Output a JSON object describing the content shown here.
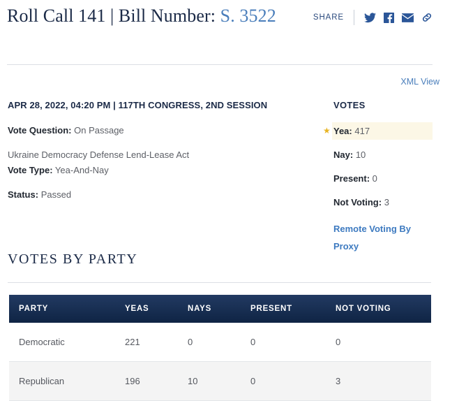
{
  "header": {
    "title_prefix": "Roll Call 141 | Bill Number: ",
    "bill_number": "S. 3522",
    "share_label": "SHARE",
    "icons": [
      "twitter-icon",
      "facebook-icon",
      "email-icon",
      "link-icon"
    ]
  },
  "xml_view": "XML View",
  "meta": {
    "datestamp": "APR 28, 2022, 04:20 PM | 117TH CONGRESS, 2ND SESSION",
    "vote_question_label": "Vote Question:",
    "vote_question_value": "On Passage",
    "bill_title": "Ukraine Democracy Defense Lend-Lease Act",
    "vote_type_label": "Vote Type:",
    "vote_type_value": "Yea-And-Nay",
    "status_label": "Status:",
    "status_value": "Passed"
  },
  "votes": {
    "heading": "VOTES",
    "yea_label": "Yea:",
    "yea_value": "417",
    "nay_label": "Nay:",
    "nay_value": "10",
    "present_label": "Present:",
    "present_value": "0",
    "not_voting_label": "Not Voting:",
    "not_voting_value": "3",
    "proxy_link": "Remote Voting By Proxy",
    "highlight_color": "#fcf7e6",
    "star_color": "#e8b423"
  },
  "party_section": {
    "heading": "VOTES BY PARTY",
    "columns": [
      "PARTY",
      "YEAS",
      "NAYS",
      "PRESENT",
      "NOT VOTING"
    ],
    "rows": [
      {
        "party": "Democratic",
        "yeas": "221",
        "nays": "0",
        "present": "0",
        "not_voting": "0"
      },
      {
        "party": "Republican",
        "yeas": "196",
        "nays": "10",
        "present": "0",
        "not_voting": "3"
      }
    ]
  },
  "colors": {
    "navy": "#1b2a47",
    "link_blue": "#4a7ebb",
    "table_header": "#0f2444"
  }
}
